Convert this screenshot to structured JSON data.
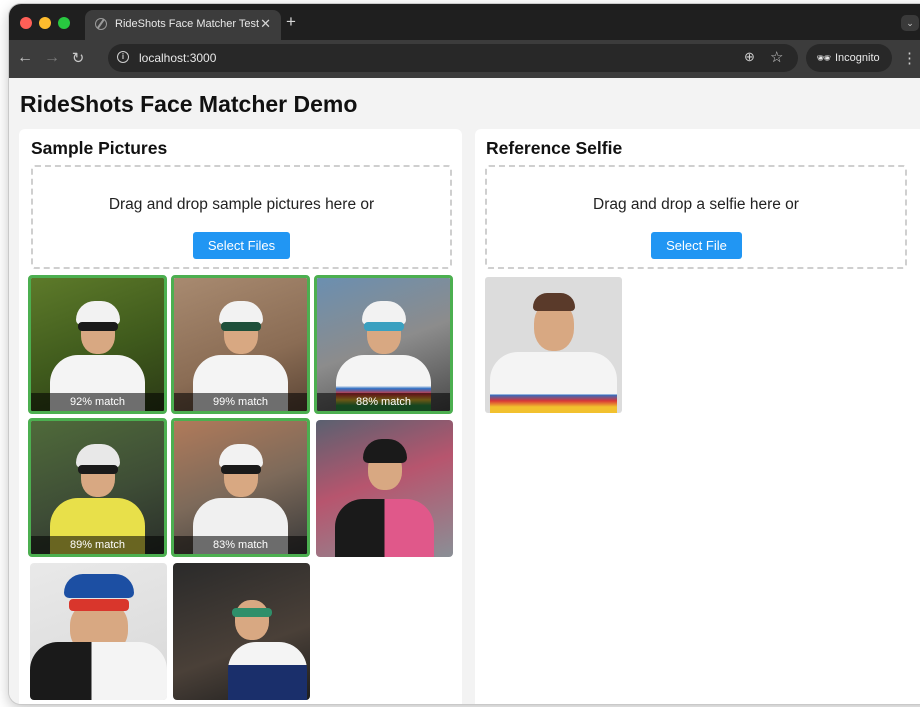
{
  "browser": {
    "tab_title": "RideShots Face Matcher Test",
    "tab_close": "✕",
    "new_tab": "+",
    "url": "localhost:3000",
    "incognito_label": "Incognito",
    "icons": [
      "globe-icon",
      "back-arrow-icon",
      "forward-arrow-icon",
      "reload-icon",
      "info-icon",
      "zoom-icon",
      "star-icon",
      "incognito-icon",
      "more-icon",
      "chevron-down-icon"
    ]
  },
  "page": {
    "title": "RideShots Face Matcher Demo"
  },
  "sample_panel": {
    "title": "Sample Pictures",
    "drop_text": "Drag and drop sample pictures here or",
    "button_label": "Select Files",
    "button_color": "#2196f3",
    "match_border_color": "#4caf50",
    "thumbnails": [
      {
        "match": "92% match",
        "matched": true
      },
      {
        "match": "99% match",
        "matched": true
      },
      {
        "match": "88% match",
        "matched": true
      },
      {
        "match": "89% match",
        "matched": true
      },
      {
        "match": "83% match",
        "matched": true
      },
      {
        "match": "",
        "matched": false
      },
      {
        "match": "",
        "matched": false
      },
      {
        "match": "",
        "matched": false
      }
    ]
  },
  "reference_panel": {
    "title": "Reference Selfie",
    "drop_text": "Drag and drop a selfie here or",
    "button_label": "Select File"
  }
}
